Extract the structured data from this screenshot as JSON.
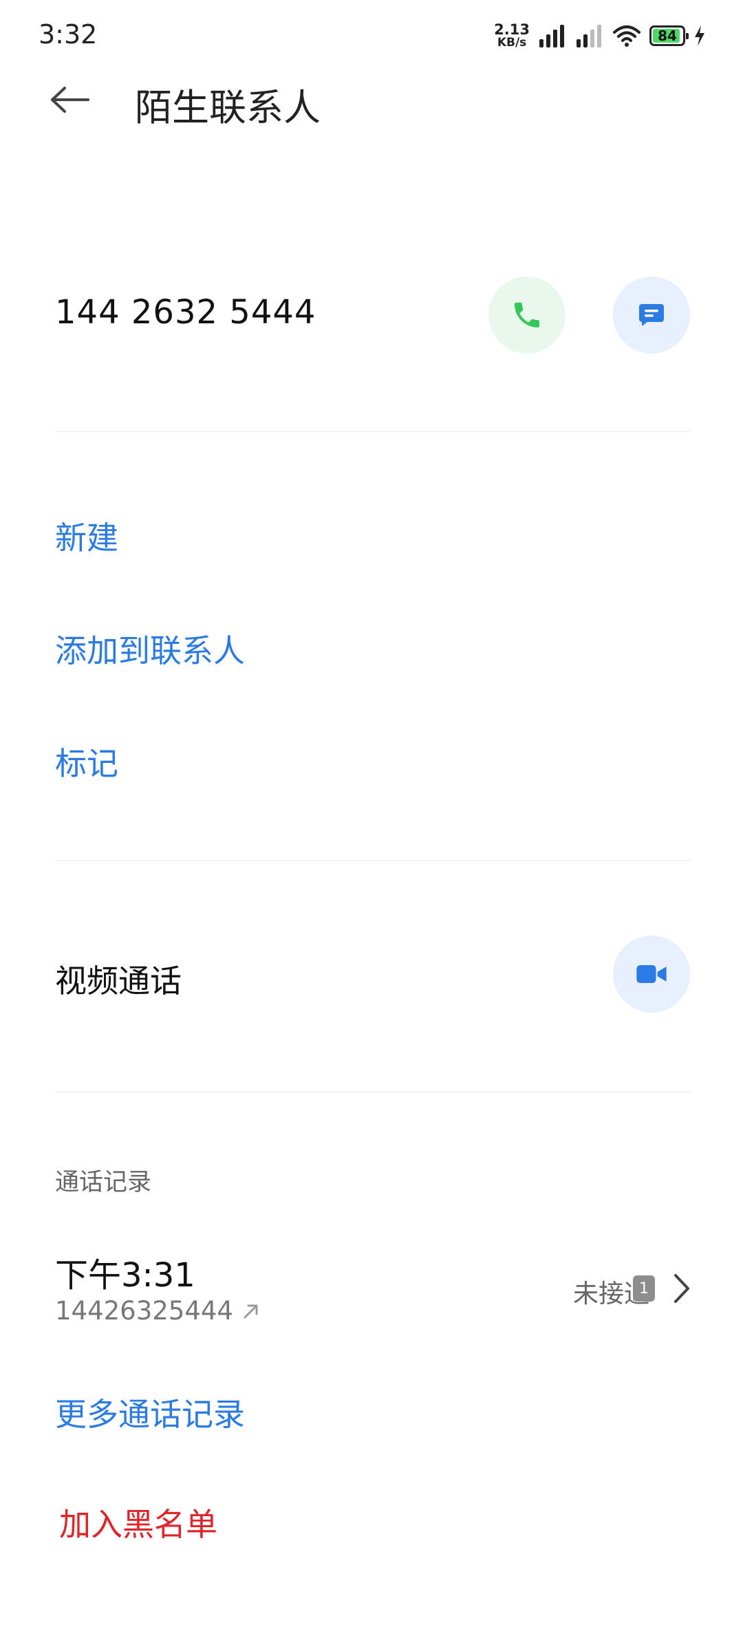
{
  "status_bar": {
    "time": "3:32",
    "net_speed_value": "2.13",
    "net_speed_unit": "KB/s",
    "battery_level": "84",
    "icons": [
      "signal-icon",
      "signal-icon",
      "wifi-icon",
      "battery-icon",
      "charging-icon"
    ]
  },
  "header": {
    "title": "陌生联系人",
    "back_icon": "back-arrow-icon"
  },
  "contact": {
    "number": "144 2632 5444",
    "call_icon": "phone-icon",
    "message_icon": "message-icon"
  },
  "actions": {
    "new": "新建",
    "add_to_contacts": "添加到联系人",
    "mark": "标记"
  },
  "video_call": {
    "label": "视频通话",
    "icon": "video-camera-icon"
  },
  "call_log": {
    "section_title": "通话记录",
    "entries": [
      {
        "time": "下午3:31",
        "number": "14426325444",
        "direction_icon": "outgoing-arrow-icon",
        "status": "未接通",
        "sim": "1"
      }
    ],
    "more": "更多通话记录"
  },
  "blacklist": "加入黑名单",
  "colors": {
    "accent_blue": "#2b7be4",
    "call_green": "#34c759",
    "danger_red": "#e0242a",
    "call_bg": "#e8f8ec",
    "msg_bg": "#e8f0fd"
  }
}
